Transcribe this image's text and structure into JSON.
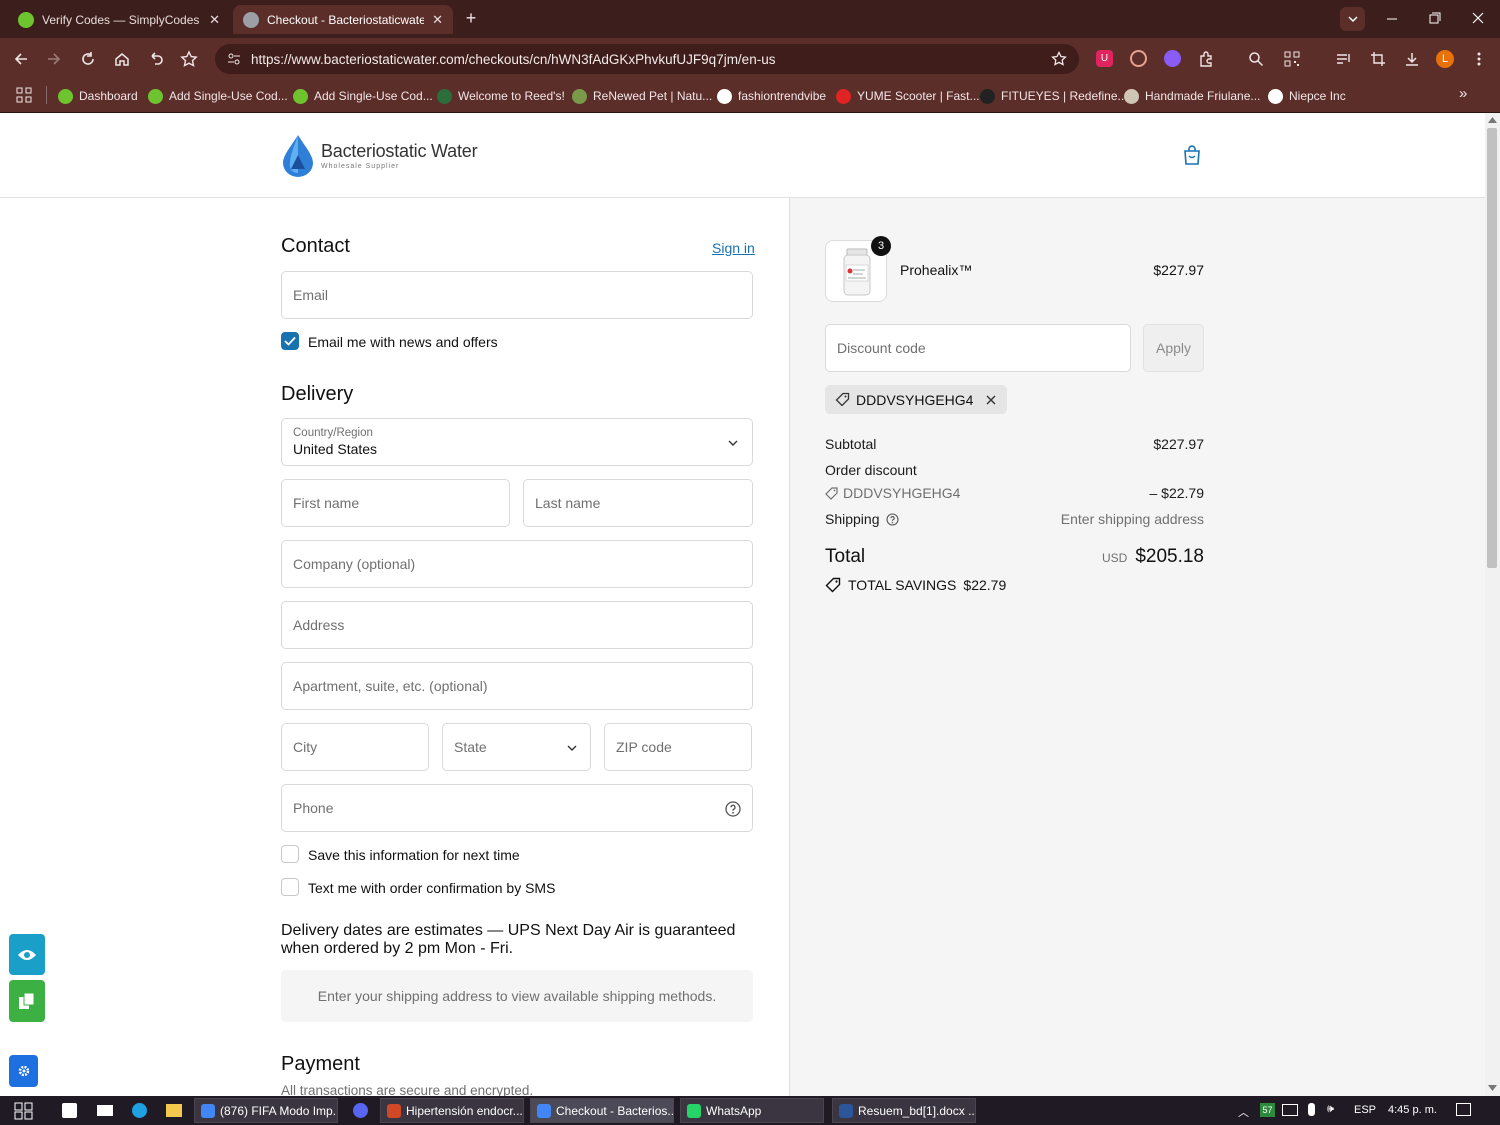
{
  "browser": {
    "tabs": [
      {
        "title": "Verify Codes — SimplyCodes",
        "close": "✕"
      },
      {
        "title": "Checkout - Bacteriostaticwater.",
        "close": "✕"
      }
    ],
    "new_tab": "+",
    "url": "https://www.bacteriostaticwater.com/checkouts/cn/hWN3fAdGKxPhvkufUJF9q7jm/en-us",
    "profile_initial": "L",
    "bookmarks": [
      {
        "label": "Dashboard",
        "color": "#6ec42e"
      },
      {
        "label": "Add Single-Use Cod...",
        "color": "#6ec42e"
      },
      {
        "label": "Add Single-Use Cod...",
        "color": "#6ec42e"
      },
      {
        "label": "Welcome to Reed's!",
        "color": "#2b6e3a"
      },
      {
        "label": "ReNewed Pet | Natu...",
        "color": "#7a9a4a"
      },
      {
        "label": "fashiontrendvibe",
        "color": "#ffffff"
      },
      {
        "label": "YUME Scooter | Fast...",
        "color": "#e02424"
      },
      {
        "label": "FITUEYES | Redefine...",
        "color": "#222222"
      },
      {
        "label": "Handmade Friulane...",
        "color": "#d0c6b6"
      },
      {
        "label": "Niepce Inc",
        "color": "#ffffff"
      }
    ]
  },
  "header": {
    "brand_name": "Bacteriostatic Water",
    "brand_tagline": "Wholesale Supplier"
  },
  "contact": {
    "title": "Contact",
    "sign_in": "Sign in",
    "email_placeholder": "Email",
    "news_label": "Email me with news and offers",
    "news_checked": true
  },
  "delivery": {
    "title": "Delivery",
    "country_label": "Country/Region",
    "country_value": "United States",
    "first_name": "First name",
    "last_name": "Last name",
    "company": "Company (optional)",
    "address": "Address",
    "apartment": "Apartment, suite, etc. (optional)",
    "city": "City",
    "state": "State",
    "zip": "ZIP code",
    "phone": "Phone",
    "save_info": "Save this information for next time",
    "sms": "Text me with order confirmation by SMS",
    "estimate_note": "Delivery dates are estimates — UPS Next Day Air is guaranteed when ordered by 2 pm Mon - Fri.",
    "shipping_notice": "Enter your shipping address to view available shipping methods."
  },
  "payment": {
    "title": "Payment",
    "subtitle": "All transactions are secure and encrypted."
  },
  "summary": {
    "product_name": "Prohealix™",
    "product_qty": "3",
    "product_price": "$227.97",
    "discount_placeholder": "Discount code",
    "apply_label": "Apply",
    "applied_code": "DDDVSYHGEHG4",
    "subtotal_label": "Subtotal",
    "subtotal_value": "$227.97",
    "order_discount_label": "Order discount",
    "discount_code": "DDDVSYHGEHG4",
    "discount_value": "– $22.79",
    "shipping_label": "Shipping",
    "shipping_value": "Enter shipping address",
    "total_label": "Total",
    "currency": "USD",
    "total_value": "$205.18",
    "savings_label": "TOTAL SAVINGS",
    "savings_value": "$22.79"
  },
  "taskbar": {
    "items": [
      {
        "label": "(876) FIFA Modo Imp...",
        "color": "#4285f4"
      },
      {
        "label": "Hipertensión endocr...",
        "color": "#d24726"
      },
      {
        "label": "Checkout - Bacterios...",
        "color": "#4285f4"
      },
      {
        "label": "WhatsApp",
        "color": "#25d366"
      },
      {
        "label": "Resuem_bd[1].docx  ...",
        "color": "#2b579a"
      }
    ],
    "tray_badge": "57",
    "language": "ESP",
    "clock": "4:45 p. m."
  },
  "colors": {
    "accent": "#1773b0",
    "chrome_dark": "#3c1f1c",
    "chrome_mid": "#5b2e2a"
  }
}
